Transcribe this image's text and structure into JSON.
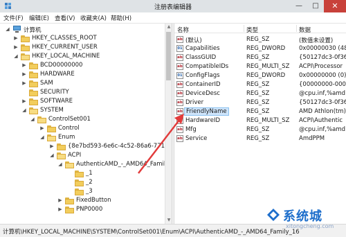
{
  "window": {
    "title": "注册表编辑器",
    "minimize_glyph": "—",
    "maximize_glyph": "□",
    "close_glyph": "✕"
  },
  "menu": [
    {
      "label": "文件(F)"
    },
    {
      "label": "编辑(E)"
    },
    {
      "label": "查看(V)"
    },
    {
      "label": "收藏夹(A)"
    },
    {
      "label": "帮助(H)"
    }
  ],
  "tree": {
    "root": "计算机",
    "items": [
      {
        "label": "HKEY_CLASSES_ROOT",
        "expander": "▶"
      },
      {
        "label": "HKEY_CURRENT_USER",
        "expander": "▶"
      },
      {
        "label": "HKEY_LOCAL_MACHINE",
        "expander": "◢"
      },
      {
        "label": "BCD00000000",
        "expander": "▶"
      },
      {
        "label": "HARDWARE",
        "expander": "▶"
      },
      {
        "label": "SAM",
        "expander": "▶"
      },
      {
        "label": "SECURITY",
        "expander": ""
      },
      {
        "label": "SOFTWARE",
        "expander": "▶"
      },
      {
        "label": "SYSTEM",
        "expander": "◢"
      },
      {
        "label": "ControlSet001",
        "expander": "◢"
      },
      {
        "label": "Control",
        "expander": "▶"
      },
      {
        "label": "Enum",
        "expander": "◢"
      },
      {
        "label": "{8e7bd593-6e6c-4c52-86a6-7717545",
        "expander": "▶"
      },
      {
        "label": "ACPI",
        "expander": "◢"
      },
      {
        "label": "AuthenticAMD_-_AMD64_Family_16",
        "expander": "◢"
      },
      {
        "label": "_1",
        "expander": ""
      },
      {
        "label": "_2",
        "expander": ""
      },
      {
        "label": "_3",
        "expander": ""
      },
      {
        "label": "FixedButton",
        "expander": "▶"
      },
      {
        "label": "PNP0000",
        "expander": "▶"
      }
    ]
  },
  "values": {
    "headers": {
      "name": "名称",
      "type": "类型",
      "data": "数据"
    },
    "rows": [
      {
        "icon": "ab",
        "name": "(默认)",
        "type": "REG_SZ",
        "data": "(数值未设置)"
      },
      {
        "icon": "bin",
        "name": "Capabilities",
        "type": "REG_DWORD",
        "data": "0x00000030 (48"
      },
      {
        "icon": "ab",
        "name": "ClassGUID",
        "type": "REG_SZ",
        "data": "{50127dc3-0f36-"
      },
      {
        "icon": "ab",
        "name": "CompatibleIDs",
        "type": "REG_MULTI_SZ",
        "data": "ACPI\\Processor"
      },
      {
        "icon": "bin",
        "name": "ConfigFlags",
        "type": "REG_DWORD",
        "data": "0x00000000 (0)"
      },
      {
        "icon": "ab",
        "name": "ContainerID",
        "type": "REG_SZ",
        "data": "{00000000-0000"
      },
      {
        "icon": "ab",
        "name": "DeviceDesc",
        "type": "REG_SZ",
        "data": "@cpu.inf,%amd"
      },
      {
        "icon": "ab",
        "name": "Driver",
        "type": "REG_SZ",
        "data": "{50127dc3-0f36-"
      },
      {
        "icon": "ab",
        "name": "FriendlyName",
        "type": "REG_SZ",
        "data": "AMD Athlon(tm)"
      },
      {
        "icon": "ab",
        "name": "HardwareID",
        "type": "REG_MULTI_SZ",
        "data": "ACPI\\Authentic"
      },
      {
        "icon": "ab",
        "name": "Mfg",
        "type": "REG_SZ",
        "data": "@cpu.inf,%amd"
      },
      {
        "icon": "ab",
        "name": "Service",
        "type": "REG_SZ",
        "data": "AmdPPM"
      }
    ],
    "selected": "FriendlyName"
  },
  "statusbar": {
    "path": "计算机\\HKEY_LOCAL_MACHINE\\SYSTEM\\ControlSet001\\Enum\\ACPI\\AuthenticAMD_-_AMD64_Family_16"
  },
  "watermark": {
    "text": "系统城",
    "url": "xitongcheng.com"
  },
  "colors": {
    "accent": "#1d6ecb",
    "annotation_arrow": "#e23b3b",
    "selection": "#cfe5fb",
    "close_button": "#c8413a"
  }
}
